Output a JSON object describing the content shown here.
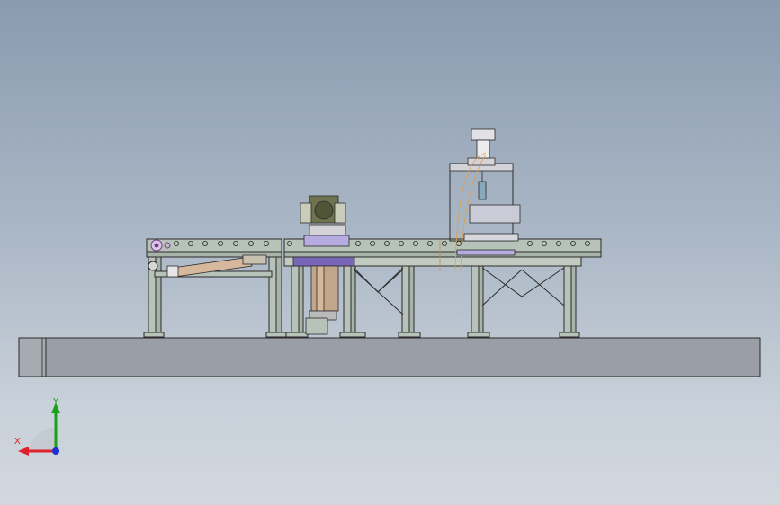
{
  "viewport": {
    "background_top": "#8a9bb0",
    "background_bottom": "#d2d8de"
  },
  "triad": {
    "x_label": "X",
    "y_label": "Y",
    "x_color": "#e0202a",
    "y_color": "#1aa01a",
    "z_color": "#1f2fd0"
  },
  "model": {
    "line_color": "#2b2b2b",
    "frame_fill": "#b7c2b8",
    "base_fill": "#9a9ea6",
    "cylinder_fill": "#d6b89c",
    "accent_purple": "#7a66b8"
  }
}
